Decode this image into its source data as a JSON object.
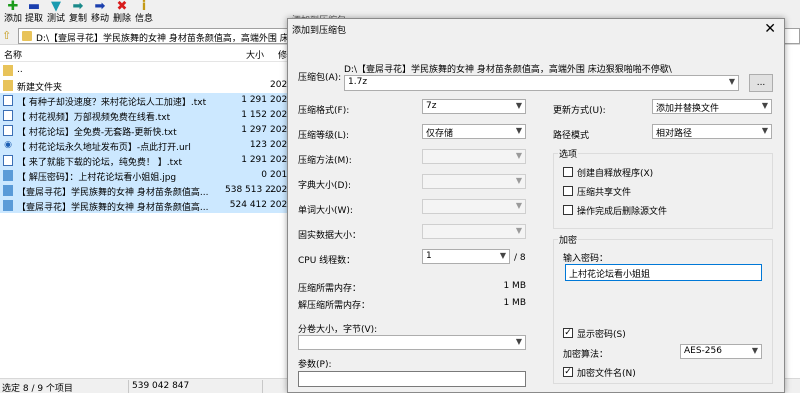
{
  "toolbar": {
    "items": [
      {
        "icon": "plus",
        "label": "添加",
        "color": "#1a9b1a"
      },
      {
        "icon": "minus",
        "label": "提取",
        "color": "#1b3fae"
      },
      {
        "icon": "check",
        "label": "测试",
        "color": "#1a9bb0"
      },
      {
        "icon": "arrow-right",
        "label": "复制",
        "color": "#1a8a8a"
      },
      {
        "icon": "arrow-right",
        "label": "移动",
        "color": "#1b3fae"
      },
      {
        "icon": "x",
        "label": "删除",
        "color": "#d81b1b"
      },
      {
        "icon": "info",
        "label": "信息",
        "color": "#c49a16"
      }
    ]
  },
  "address": {
    "path": "D:\\【壹屌寻花】学民族舞的女神 身材苗条颜值高，高端外围 床边"
  },
  "list": {
    "headers": {
      "name": "名称",
      "size": "大小",
      "date": "修"
    },
    "rows": [
      {
        "icon": "folder",
        "name": "..",
        "size": "",
        "date": "",
        "selected": false
      },
      {
        "icon": "folder",
        "name": "新建文件夹",
        "size": "",
        "date": "202",
        "selected": false
      },
      {
        "icon": "txt",
        "name": "【 有种子却没速度？来村花论坛人工加速】.txt",
        "size": "1 291",
        "date": "202",
        "selected": true
      },
      {
        "icon": "txt",
        "name": "【 村花视频】万部视频免费在线看.txt",
        "size": "1 152",
        "date": "202",
        "selected": true
      },
      {
        "icon": "txt",
        "name": "【 村花论坛】全免费-无套路-更新快.txt",
        "size": "1 297",
        "date": "202",
        "selected": true
      },
      {
        "icon": "url",
        "name": "【 村花论坛永久地址发布页】-点此打开.url",
        "size": "123",
        "date": "202",
        "selected": true
      },
      {
        "icon": "txt",
        "name": "【 来了就能下载的论坛，纯免费！ 】.txt",
        "size": "1 291",
        "date": "202",
        "selected": true
      },
      {
        "icon": "jpg",
        "name": "【 解压密码】：上村花论坛看小姐姐.jpg",
        "size": "0",
        "date": "201",
        "selected": true
      },
      {
        "icon": "archive",
        "name": "【壹屌寻花】学民族舞的女神 身材苗条颜值高...",
        "size": "538 513 2...",
        "date": "202",
        "selected": true
      },
      {
        "icon": "archive",
        "name": "【壹屌寻花】学民族舞的女神 身材苗条颜值高...",
        "size": "524 412",
        "date": "202",
        "selected": true
      }
    ]
  },
  "status": {
    "selection": "选定 8 / 9 个项目",
    "size": "539 042 847"
  },
  "dialog": {
    "behind_title": "添加到压缩包",
    "title": "添加到压缩包",
    "archive_label": "压缩包(A):",
    "archive_path": "D:\\【壹屌寻花】学民族舞的女神 身材苗条颜值高，高端外围 床边狠狠啪啪不停歇\\",
    "archive_name": "1.7z",
    "browse_label": "...",
    "format_label": "压缩格式(F):",
    "format_value": "7z",
    "level_label": "压缩等级(L):",
    "level_value": "仅存储",
    "method_label": "压缩方法(M):",
    "dict_label": "字典大小(D):",
    "word_label": "单词大小(W):",
    "solid_label": "固实数据大小：",
    "cpu_label": "CPU 线程数：",
    "cpu_value": "1",
    "cpu_max": "/ 8",
    "mem_comp_label": "压缩所需内存：",
    "mem_comp_value": "1 MB",
    "mem_decomp_label": "解压缩所需内存：",
    "mem_decomp_value": "1 MB",
    "split_label": "分卷大小，字节(V):",
    "params_label": "参数(P):",
    "update_label": "更新方式(U):",
    "update_value": "添加并替换文件",
    "pathmode_label": "路径模式",
    "pathmode_value": "相对路径",
    "options_title": "选项",
    "opt_sfx": "创建自释放程序(X)",
    "opt_shared": "压缩共享文件",
    "opt_delete": "操作完成后删除源文件",
    "enc_title": "加密",
    "pw_label": "输入密码：",
    "pw_value": "上村花论坛看小姐姐",
    "show_pw": "显示密码(S)",
    "enc_method_label": "加密算法：",
    "enc_method_value": "AES-256",
    "enc_names": "加密文件名(N)"
  }
}
